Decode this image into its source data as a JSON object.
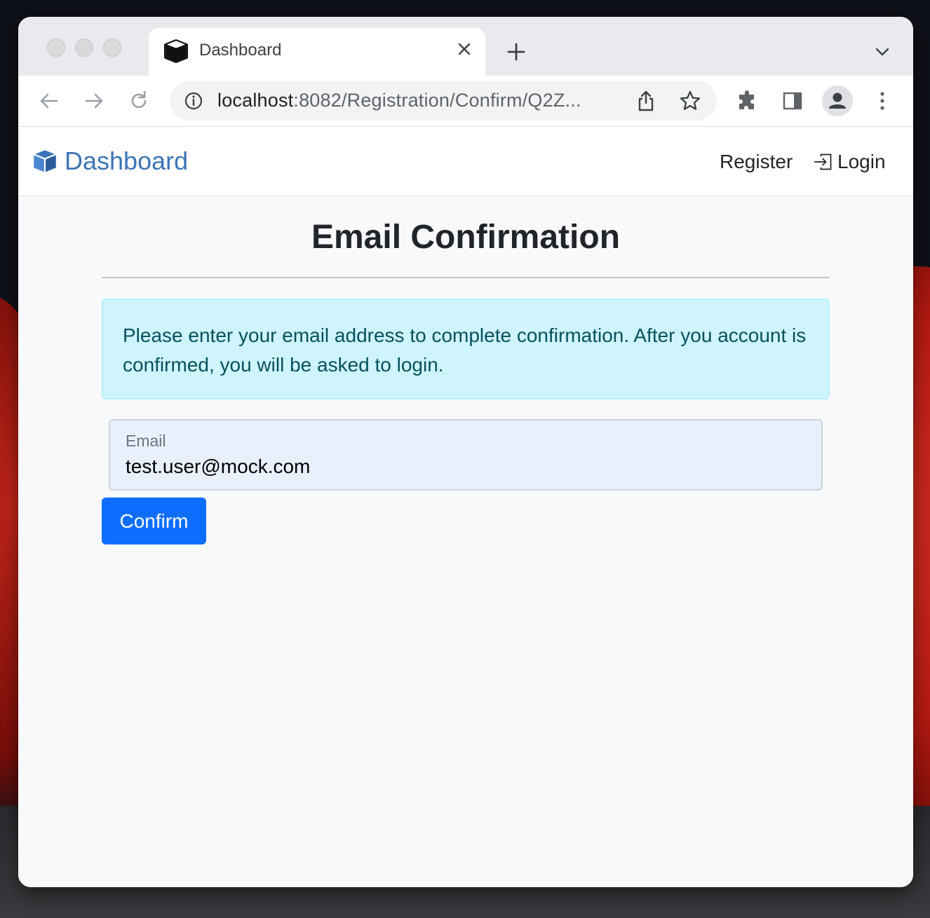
{
  "browser": {
    "tab_title": "Dashboard",
    "url_host": "localhost",
    "url_rest": ":8082/Registration/Confirm/Q2Z..."
  },
  "navbar": {
    "brand": "Dashboard",
    "register_label": "Register",
    "login_label": "Login"
  },
  "main": {
    "title": "Email Confirmation",
    "alert_text": "Please enter your email address to complete confirmation. After you account is confirmed, you will be asked to login.",
    "email_label": "Email",
    "email_value": "test.user@mock.com",
    "confirm_label": "Confirm"
  },
  "colors": {
    "brand": "#3d74b8",
    "primary": "#0d6efd",
    "alert_bg": "#cff4fc",
    "alert_text": "#055160"
  },
  "icons": {
    "brand": "box-icon",
    "login": "box-arrow-in-right-icon"
  }
}
